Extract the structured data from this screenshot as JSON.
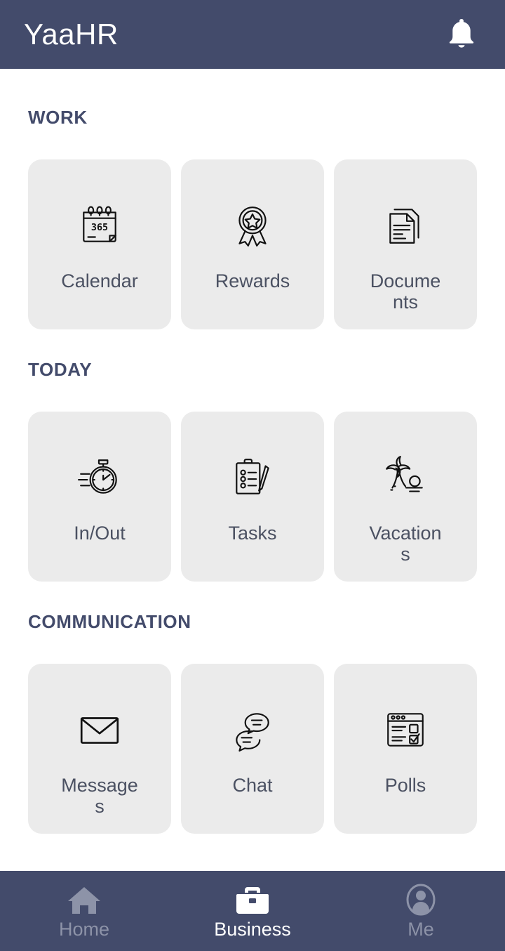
{
  "header": {
    "title": "YaaHR",
    "notification_icon": "bell-icon",
    "background_color": "#434b6b",
    "text_color": "#ffffff"
  },
  "sections": [
    {
      "id": "work",
      "title": "WORK",
      "cards": [
        {
          "id": "calendar",
          "label": "Calendar",
          "icon": "calendar-365-icon"
        },
        {
          "id": "rewards",
          "label": "Rewards",
          "icon": "medal-ribbon-icon"
        },
        {
          "id": "documents",
          "label": "Documents",
          "icon": "documents-icon"
        }
      ]
    },
    {
      "id": "today",
      "title": "TODAY",
      "cards": [
        {
          "id": "inout",
          "label": "In/Out",
          "icon": "stopwatch-icon"
        },
        {
          "id": "tasks",
          "label": "Tasks",
          "icon": "clipboard-pencil-icon"
        },
        {
          "id": "vacations",
          "label": "Vacations",
          "icon": "palm-tree-sunset-icon"
        }
      ]
    },
    {
      "id": "communication",
      "title": "COMMUNICATION",
      "cards": [
        {
          "id": "messages",
          "label": "Messages",
          "icon": "envelope-icon"
        },
        {
          "id": "chat",
          "label": "Chat",
          "icon": "chat-bubbles-icon"
        },
        {
          "id": "polls",
          "label": "Polls",
          "icon": "poll-window-icon"
        }
      ]
    }
  ],
  "bottom_nav": {
    "items": [
      {
        "id": "home",
        "label": "Home",
        "icon": "home-icon",
        "active": false
      },
      {
        "id": "business",
        "label": "Business",
        "icon": "briefcase-icon",
        "active": true
      },
      {
        "id": "me",
        "label": "Me",
        "icon": "person-icon",
        "active": false
      }
    ],
    "active_color": "#ffffff",
    "inactive_color": "#8d93a8",
    "background_color": "#434b6b"
  },
  "theme": {
    "card_background": "#ebebeb",
    "card_label_color": "#4b5162",
    "section_title_color": "#434b6b",
    "page_background": "#ffffff"
  }
}
